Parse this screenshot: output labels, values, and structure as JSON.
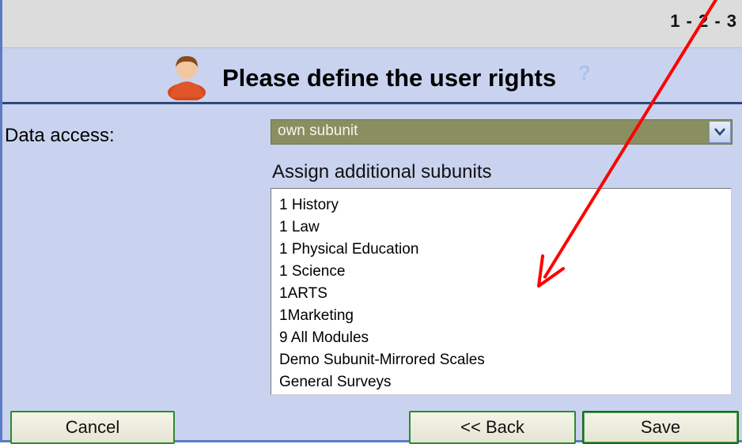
{
  "wizard": {
    "steps": "1 - 2 - 3"
  },
  "header": {
    "title": "Please define the user rights",
    "help_icon": "?"
  },
  "form": {
    "data_access_label": "Data access:",
    "data_access_value": "own subunit",
    "assign_label": "Assign additional subunits",
    "subunits": [
      "1 History",
      "1 Law",
      "1 Physical Education",
      "1 Science",
      "1ARTS",
      "1Marketing",
      "9 All Modules",
      "Demo Subunit-Mirrored Scales",
      "General Surveys"
    ]
  },
  "buttons": {
    "cancel": "Cancel",
    "back": "<< Back",
    "save": "Save"
  },
  "colors": {
    "panel_bg": "#c9d3ef",
    "header_rule": "#2d4a7c",
    "select_bg": "#8a8f62",
    "button_border": "#2f8a2f",
    "annotation_arrow": "#ff0000"
  },
  "icons": {
    "avatar": "user-avatar-icon",
    "dropdown": "chevron-down-icon",
    "help": "help-icon"
  }
}
